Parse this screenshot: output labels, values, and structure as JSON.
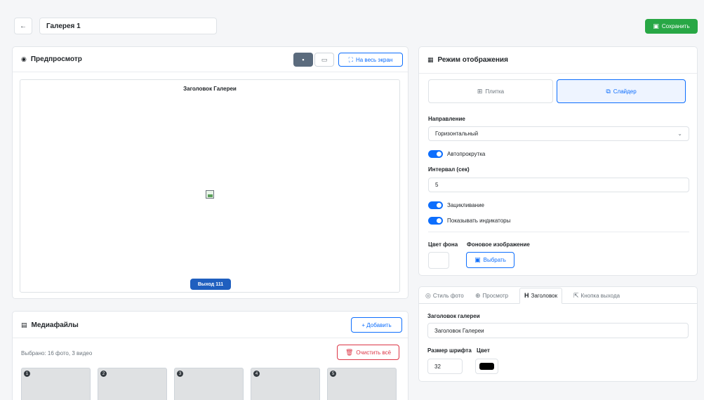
{
  "header": {
    "back_icon": "arrow-left-icon",
    "back_glyph": "←",
    "gallery_name": "Галерея 1",
    "save_label": "Сохранить",
    "save_icon": "save-icon"
  },
  "preview": {
    "title": "Предпросмотр",
    "fullscreen_label": "На весь экран",
    "gallery_heading": "Заголовок Галереи",
    "exit_label": "Выход 111"
  },
  "display_mode": {
    "title": "Режим отображения",
    "tile_label": "Плитка",
    "slider_label": "Слайдер",
    "direction_label": "Направление",
    "direction_value": "Горизонтальный",
    "autoscroll_label": "Автопрокрутка",
    "interval_label": "Интервал (сек)",
    "interval_value": "5",
    "loop_label": "Зацикливание",
    "indicators_label": "Показывать индикаторы",
    "bg_color_label": "Цвет фона",
    "bg_image_label": "Фоновое изображение",
    "choose_label": "Выбрать"
  },
  "settings_tabs": {
    "tabs": [
      "Стиль фото",
      "Просмотр",
      "Заголовок",
      "Кнопка выхода"
    ],
    "active": "Заголовок",
    "heading_label": "Заголовок галереи",
    "heading_value": "Заголовок Галереи",
    "font_size_label": "Размер шрифта",
    "color_label": "Цвет",
    "font_size_value": "32",
    "color_value": "#000000"
  },
  "media": {
    "title": "Медиафайлы",
    "add_label": "+ Добавить",
    "selected_text": "Выбрано: 16 фото, 3 видео",
    "clear_label": "Очистить всё",
    "thumbs": [
      "1",
      "2",
      "3",
      "4",
      "5"
    ]
  },
  "colors": {
    "accent": "#0d6efd",
    "save_green": "#28a745",
    "danger": "#dc3545",
    "exit_button": "#1f5fbf"
  }
}
